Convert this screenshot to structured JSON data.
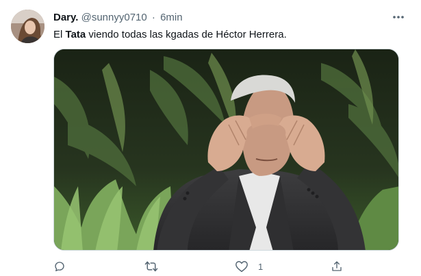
{
  "tweet": {
    "author_name": "Dary.",
    "author_handle": "@sunnyy0710",
    "separator": "·",
    "time": "6min",
    "text_before": "El ",
    "text_bold": "Tata",
    "text_after": " viendo todas las kgadas de Héctor Herrera.",
    "more_icon": "more-horizontal-icon"
  },
  "actions": {
    "reply_icon": "reply-icon",
    "retweet_icon": "retweet-icon",
    "like_icon": "heart-icon",
    "like_count": "1",
    "share_icon": "share-icon"
  },
  "colors": {
    "text_primary": "#0f1419",
    "text_secondary": "#536471",
    "border": "#cfd9de"
  }
}
